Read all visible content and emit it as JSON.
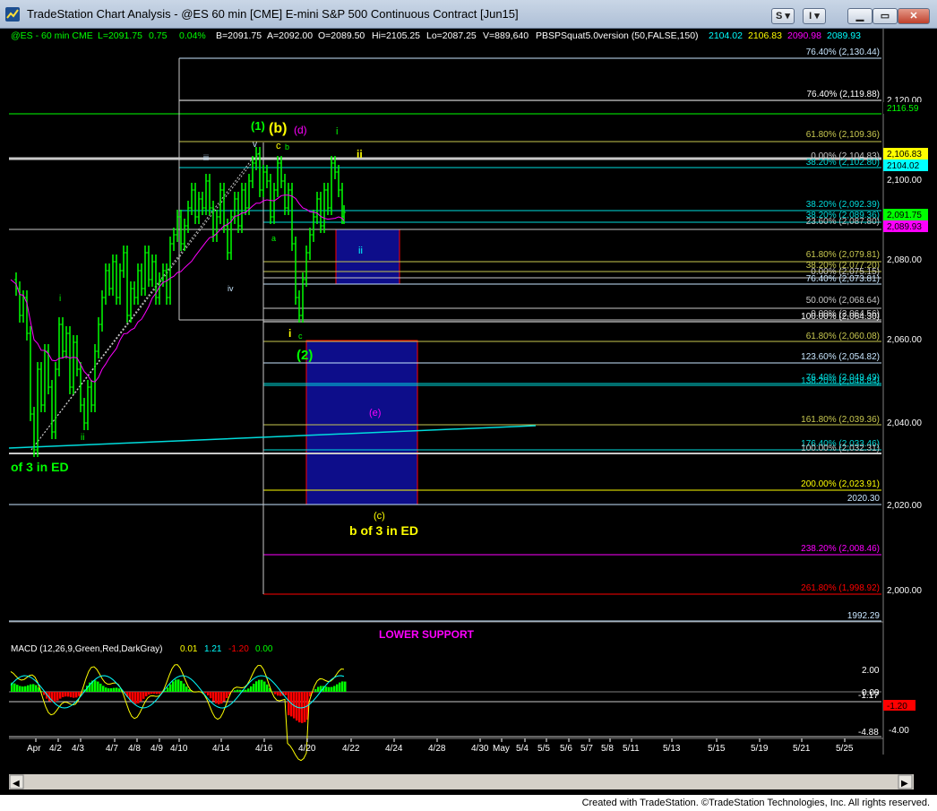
{
  "window": {
    "title": "TradeStation Chart Analysis - @ES 60 min [CME] E-mini S&P 500 Continuous Contract [Jun15]",
    "buttons": [
      "S",
      "I"
    ]
  },
  "header": {
    "symbol": "@ES - 60 min  CME",
    "last": "L=2091.75",
    "change": "0.75",
    "change_pct": "0.04%",
    "bid": "B=2091.75",
    "ask": "A=2092.00",
    "open": "O=2089.50",
    "high": "Hi=2105.25",
    "low": "Lo=2087.25",
    "volume": "V=889,640",
    "indicator": "PBSPSquat5.0version (50,FALSE,150)",
    "ind_values": [
      "2104.02",
      "2106.83",
      "2090.98",
      "2089.93"
    ]
  },
  "colors": {
    "up": "#00ff00",
    "down": "#ff0000",
    "yellow": "#ffff00",
    "magenta": "#ff00ff",
    "blue_box": "#0d0d8a"
  },
  "price_axis": {
    "labels": [
      "2,120.00",
      "2,100.00",
      "2,080.00",
      "2,060.00",
      "2,040.00",
      "2,020.00",
      "2,000.00"
    ],
    "tags": [
      {
        "text": "2116.59",
        "color": "#00ff00",
        "fg": "#000000"
      },
      {
        "text": "2,106.83",
        "color": "#ffff00",
        "fg": "#000000"
      },
      {
        "text": "2104.02",
        "color": "#00ffff",
        "fg": "#000000"
      },
      {
        "text": "2,091.75",
        "color": "#00ff00",
        "fg": "#000000"
      },
      {
        "text": "2,089.93",
        "color": "#ff00ff",
        "fg": "#000000"
      }
    ]
  },
  "fib_labels": [
    {
      "text": "76.40% (2,130.44)",
      "color": "#c8e6ff"
    },
    {
      "text": "76.40% (2,119.88)",
      "color": "#ffffff"
    },
    {
      "text": "61.80% (2,109.36)",
      "color": "#c8c850"
    },
    {
      "text": "0.00% (2,104.83)",
      "color": "#c8c8c8"
    },
    {
      "text": "38.20% (2,102.80)",
      "color": "#00dcdc"
    },
    {
      "text": "38.20% (2,092.39)",
      "color": "#00dcdc"
    },
    {
      "text": "38.20% (2,089.36)",
      "color": "#00dcdc"
    },
    {
      "text": "23.60% (2,087.80)",
      "color": "#c8c8c8"
    },
    {
      "text": "61.80% (2,079.81)",
      "color": "#c8c850"
    },
    {
      "text": "38.20% (2,077.20)",
      "color": "#c8c850"
    },
    {
      "text": "0.00% (2,075.15)",
      "color": "#c8c8c8"
    },
    {
      "text": "76.40% (2,073.81)",
      "color": "#c8e6ff"
    },
    {
      "text": "50.00% (2,068.64)",
      "color": "#c8c8c8"
    },
    {
      "text": "0.00% (2,064.56)",
      "color": "#c8c8c8"
    },
    {
      "text": "100.00% (2,064.30)",
      "color": "#ffffff"
    },
    {
      "text": "61.80% (2,060.08)",
      "color": "#c8c850"
    },
    {
      "text": "123.60% (2,054.82)",
      "color": "#c8e6ff"
    },
    {
      "text": "76.40% (2,049.49)",
      "color": "#00dcdc"
    },
    {
      "text": "138.20% (2,048.84)",
      "color": "#00dcdc"
    },
    {
      "text": "161.80% (2,039.36)",
      "color": "#c8c850"
    },
    {
      "text": "176.40% (2,033.46)",
      "color": "#00dcdc"
    },
    {
      "text": "100.00% (2,032.31)",
      "color": "#c8c8c8"
    },
    {
      "text": "200.00% (2,023.91)",
      "color": "#ffff00"
    },
    {
      "text": "2020.30",
      "color": "#c8e6ff"
    },
    {
      "text": "238.20% (2,008.46)",
      "color": "#ff00ff"
    },
    {
      "text": "261.80% (1,998.92)",
      "color": "#ff0000"
    },
    {
      "text": "1992.29",
      "color": "#c8e6ff"
    }
  ],
  "wave_labels": [
    {
      "text": "(1)",
      "color": "#00ff00"
    },
    {
      "text": "(b)",
      "color": "#ffff00"
    },
    {
      "text": "(d)",
      "color": "#ff00ff"
    },
    {
      "text": "i",
      "color": "#00ff00"
    },
    {
      "text": "ii",
      "color": "#ffff00"
    },
    {
      "text": "v",
      "color": "#c8e6ff"
    },
    {
      "text": "c",
      "color": "#ffff00"
    },
    {
      "text": "b",
      "color": "#00ff00"
    },
    {
      "text": "iii",
      "color": "#c8e6ff"
    },
    {
      "text": "a",
      "color": "#00ff00"
    },
    {
      "text": "iv",
      "color": "#c8e6ff"
    },
    {
      "text": "ii",
      "color": "#00ffff"
    },
    {
      "text": "i",
      "color": "#ffff00"
    },
    {
      "text": "c",
      "color": "#00ff00"
    },
    {
      "text": "(2)",
      "color": "#00ff00"
    },
    {
      "text": "i",
      "color": "#00ff00"
    },
    {
      "text": "ii",
      "color": "#00ff00"
    },
    {
      "text": "(e)",
      "color": "#ff00ff"
    },
    {
      "text": "(c)",
      "color": "#ffff00"
    },
    {
      "text": "b of 3 in ED",
      "color": "#ffff00"
    },
    {
      "text": "of 3 in ED",
      "color": "#00ff00"
    }
  ],
  "support_label": "LOWER SUPPORT",
  "macd": {
    "title": "MACD (12,26,9,Green,Red,DarkGray)",
    "values": [
      {
        "text": "0.01",
        "color": "#ffff00"
      },
      {
        "text": "1.21",
        "color": "#00ffff"
      },
      {
        "text": "-1.20",
        "color": "#ff0000"
      },
      {
        "text": "0.00",
        "color": "#00ff00"
      }
    ],
    "axis_labels": [
      "2.00",
      "0.00",
      "-1.17",
      "-4.00",
      "-4.88"
    ],
    "tag": "-1.20"
  },
  "time_axis": [
    "Apr",
    "4/2",
    "4/3",
    "4/7",
    "4/8",
    "4/9",
    "4/10",
    "4/14",
    "4/16",
    "4/20",
    "4/22",
    "4/24",
    "4/28",
    "4/30",
    "May",
    "5/4",
    "5/5",
    "5/6",
    "5/7",
    "5/8",
    "5/11",
    "5/13",
    "5/15",
    "5/19",
    "5/21",
    "5/25"
  ],
  "footer": "Created with TradeStation. ©TradeStation Technologies, Inc. All rights reserved."
}
